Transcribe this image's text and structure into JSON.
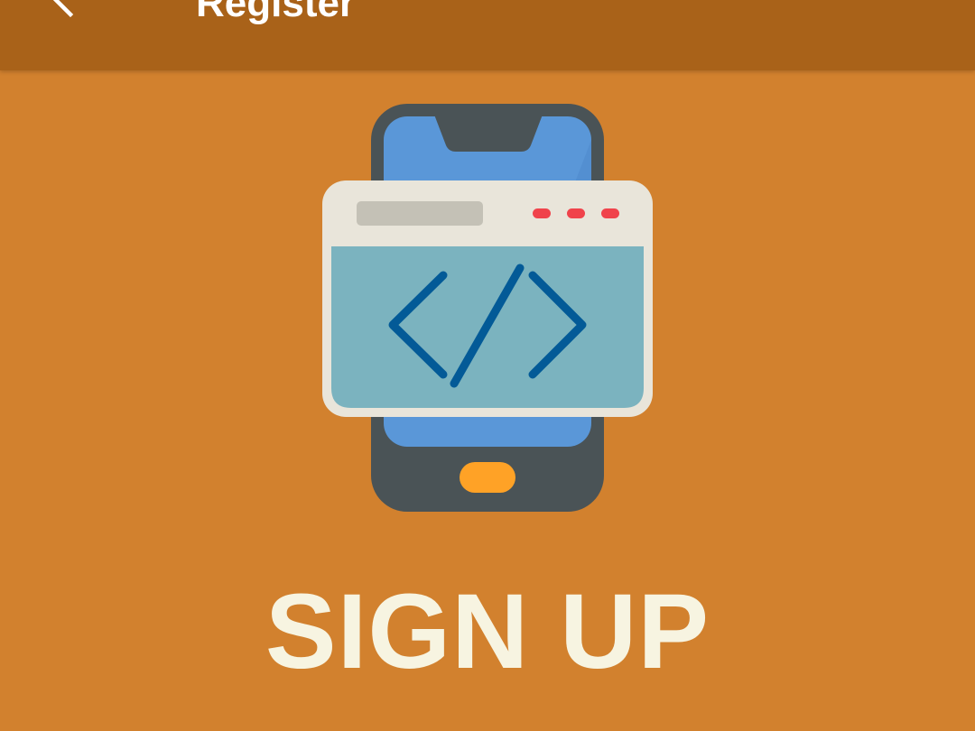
{
  "app_bar": {
    "title": "Register",
    "back_icon": "arrow-back-icon"
  },
  "hero": {
    "icon": "mobile-code-window-icon",
    "headline": "SIGN UP"
  },
  "colors": {
    "background": "#D2812E",
    "app_bar": "#A96219",
    "headline": "#F7F4E1",
    "phone_body": "#4A5356",
    "phone_screen": "#5A97D8",
    "window_frame": "#E9E5DA",
    "window_content": "#7BB3BF",
    "code_symbol": "#035A97",
    "home_button": "#FFA226",
    "window_dots": "#F0434B"
  }
}
